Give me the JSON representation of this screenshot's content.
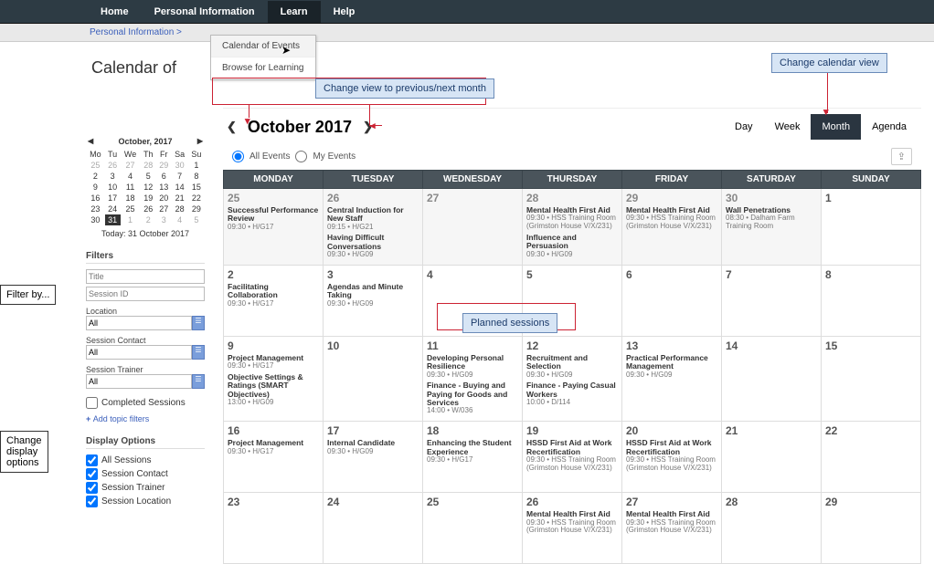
{
  "nav": {
    "items": [
      "Home",
      "Personal Information",
      "Learn",
      "Help"
    ],
    "active": "Learn"
  },
  "breadcrumb": {
    "text": "Personal Information  >"
  },
  "dropdown": {
    "item0": "Calendar of Events",
    "item1": "Browse for Learning"
  },
  "page_title": "Calendar of",
  "mini_cal": {
    "title": "October, 2017",
    "dow": [
      "Mo",
      "Tu",
      "We",
      "Th",
      "Fr",
      "Sa",
      "Su"
    ],
    "today_label": "Today: 31 October 2017"
  },
  "filters": {
    "heading": "Filters",
    "title_ph": "Title",
    "session_ph": "Session ID",
    "location_lbl": "Location",
    "location_val": "All",
    "contact_lbl": "Session Contact",
    "contact_val": "All",
    "trainer_lbl": "Session Trainer",
    "trainer_val": "All",
    "completed_lbl": "Completed Sessions",
    "addtopic": "Add topic filters"
  },
  "display": {
    "heading": "Display Options",
    "opts": [
      "All Sessions",
      "Session Contact",
      "Session Trainer",
      "Session Location"
    ]
  },
  "monthbar": {
    "title": "October 2017"
  },
  "views": {
    "day": "Day",
    "week": "Week",
    "month": "Month",
    "agenda": "Agenda"
  },
  "radios": {
    "all": "All Events",
    "my": "My Events"
  },
  "day_headers": [
    "MONDAY",
    "TUESDAY",
    "WEDNESDAY",
    "THURSDAY",
    "FRIDAY",
    "SATURDAY",
    "SUNDAY"
  ],
  "weeks": [
    [
      {
        "n": "25",
        "dim": true,
        "ev": [
          {
            "t": "Successful Performance Review",
            "d": "09:30 • H/G17"
          }
        ]
      },
      {
        "n": "26",
        "dim": true,
        "ev": [
          {
            "t": "Central Induction for New Staff",
            "d": "09:15 • H/G21"
          },
          {
            "t": "Having Difficult Conversations",
            "d": "09:30 • H/G09"
          }
        ]
      },
      {
        "n": "27",
        "dim": true,
        "ev": []
      },
      {
        "n": "28",
        "dim": true,
        "ev": [
          {
            "t": "Mental Health First Aid",
            "d": "09:30 • HSS Training Room (Grimston House V/X/231)"
          },
          {
            "t": "Influence and Persuasion",
            "d": "09:30 • H/G09"
          }
        ]
      },
      {
        "n": "29",
        "dim": true,
        "ev": [
          {
            "t": "Mental Health First Aid",
            "d": "09:30 • HSS Training Room (Grimston House V/X/231)"
          }
        ]
      },
      {
        "n": "30",
        "dim": true,
        "ev": [
          {
            "t": "Wall Penetrations",
            "d": "08:30 • Dalham Farm Training Room"
          }
        ]
      },
      {
        "n": "1",
        "ev": []
      }
    ],
    [
      {
        "n": "2",
        "ev": [
          {
            "t": "Facilitating Collaboration",
            "d": "09:30 • H/G17"
          }
        ]
      },
      {
        "n": "3",
        "ev": [
          {
            "t": "Agendas and Minute Taking",
            "d": "09:30 • H/G09"
          }
        ]
      },
      {
        "n": "4",
        "ev": []
      },
      {
        "n": "5",
        "ev": []
      },
      {
        "n": "6",
        "ev": []
      },
      {
        "n": "7",
        "ev": []
      },
      {
        "n": "8",
        "ev": []
      }
    ],
    [
      {
        "n": "9",
        "ev": [
          {
            "t": "Project Management",
            "d": "09:30 • H/G17"
          },
          {
            "t": "Objective Settings & Ratings (SMART Objectives)",
            "d": "13:00 • H/G09"
          }
        ]
      },
      {
        "n": "10",
        "ev": []
      },
      {
        "n": "11",
        "ev": [
          {
            "t": "Developing Personal Resilience",
            "d": "09:30 • H/G09"
          },
          {
            "t": "Finance - Buying and Paying for Goods and Services",
            "d": "14:00 • W/036"
          }
        ]
      },
      {
        "n": "12",
        "ev": [
          {
            "t": "Recruitment and Selection",
            "d": "09:30 • H/G09"
          },
          {
            "t": "Finance - Paying Casual Workers",
            "d": "10:00 • D/114"
          }
        ]
      },
      {
        "n": "13",
        "ev": [
          {
            "t": "Practical Performance Management",
            "d": "09:30 • H/G09"
          }
        ]
      },
      {
        "n": "14",
        "ev": []
      },
      {
        "n": "15",
        "ev": []
      }
    ],
    [
      {
        "n": "16",
        "ev": [
          {
            "t": "Project Management",
            "d": "09:30 • H/G17"
          }
        ]
      },
      {
        "n": "17",
        "ev": [
          {
            "t": "Internal Candidate",
            "d": "09:30 • H/G09"
          }
        ]
      },
      {
        "n": "18",
        "ev": [
          {
            "t": "Enhancing the Student Experience",
            "d": "09:30 • H/G17"
          }
        ]
      },
      {
        "n": "19",
        "ev": [
          {
            "t": "HSSD First Aid at Work Recertification",
            "d": "09:30 • HSS Training Room (Grimston House V/X/231)"
          }
        ]
      },
      {
        "n": "20",
        "ev": [
          {
            "t": "HSSD First Aid at Work Recertification",
            "d": "09:30 • HSS Training Room (Grimston House V/X/231)"
          }
        ]
      },
      {
        "n": "21",
        "ev": []
      },
      {
        "n": "22",
        "ev": []
      }
    ],
    [
      {
        "n": "23",
        "ev": []
      },
      {
        "n": "24",
        "ev": []
      },
      {
        "n": "25",
        "ev": []
      },
      {
        "n": "26",
        "ev": [
          {
            "t": "Mental Health First Aid",
            "d": "09:30 • HSS Training Room (Grimston House V/X/231)"
          }
        ]
      },
      {
        "n": "27",
        "ev": [
          {
            "t": "Mental Health First Aid",
            "d": "09:30 • HSS Training Room (Grimston House V/X/231)"
          }
        ]
      },
      {
        "n": "28",
        "ev": []
      },
      {
        "n": "29",
        "ev": []
      }
    ]
  ],
  "callouts": {
    "view_change": "Change calendar view",
    "prev_next": "Change view to previous/next month",
    "planned": "Planned sessions",
    "filter_by": "Filter by...",
    "display_opts": "Change\ndisplay\noptions"
  }
}
